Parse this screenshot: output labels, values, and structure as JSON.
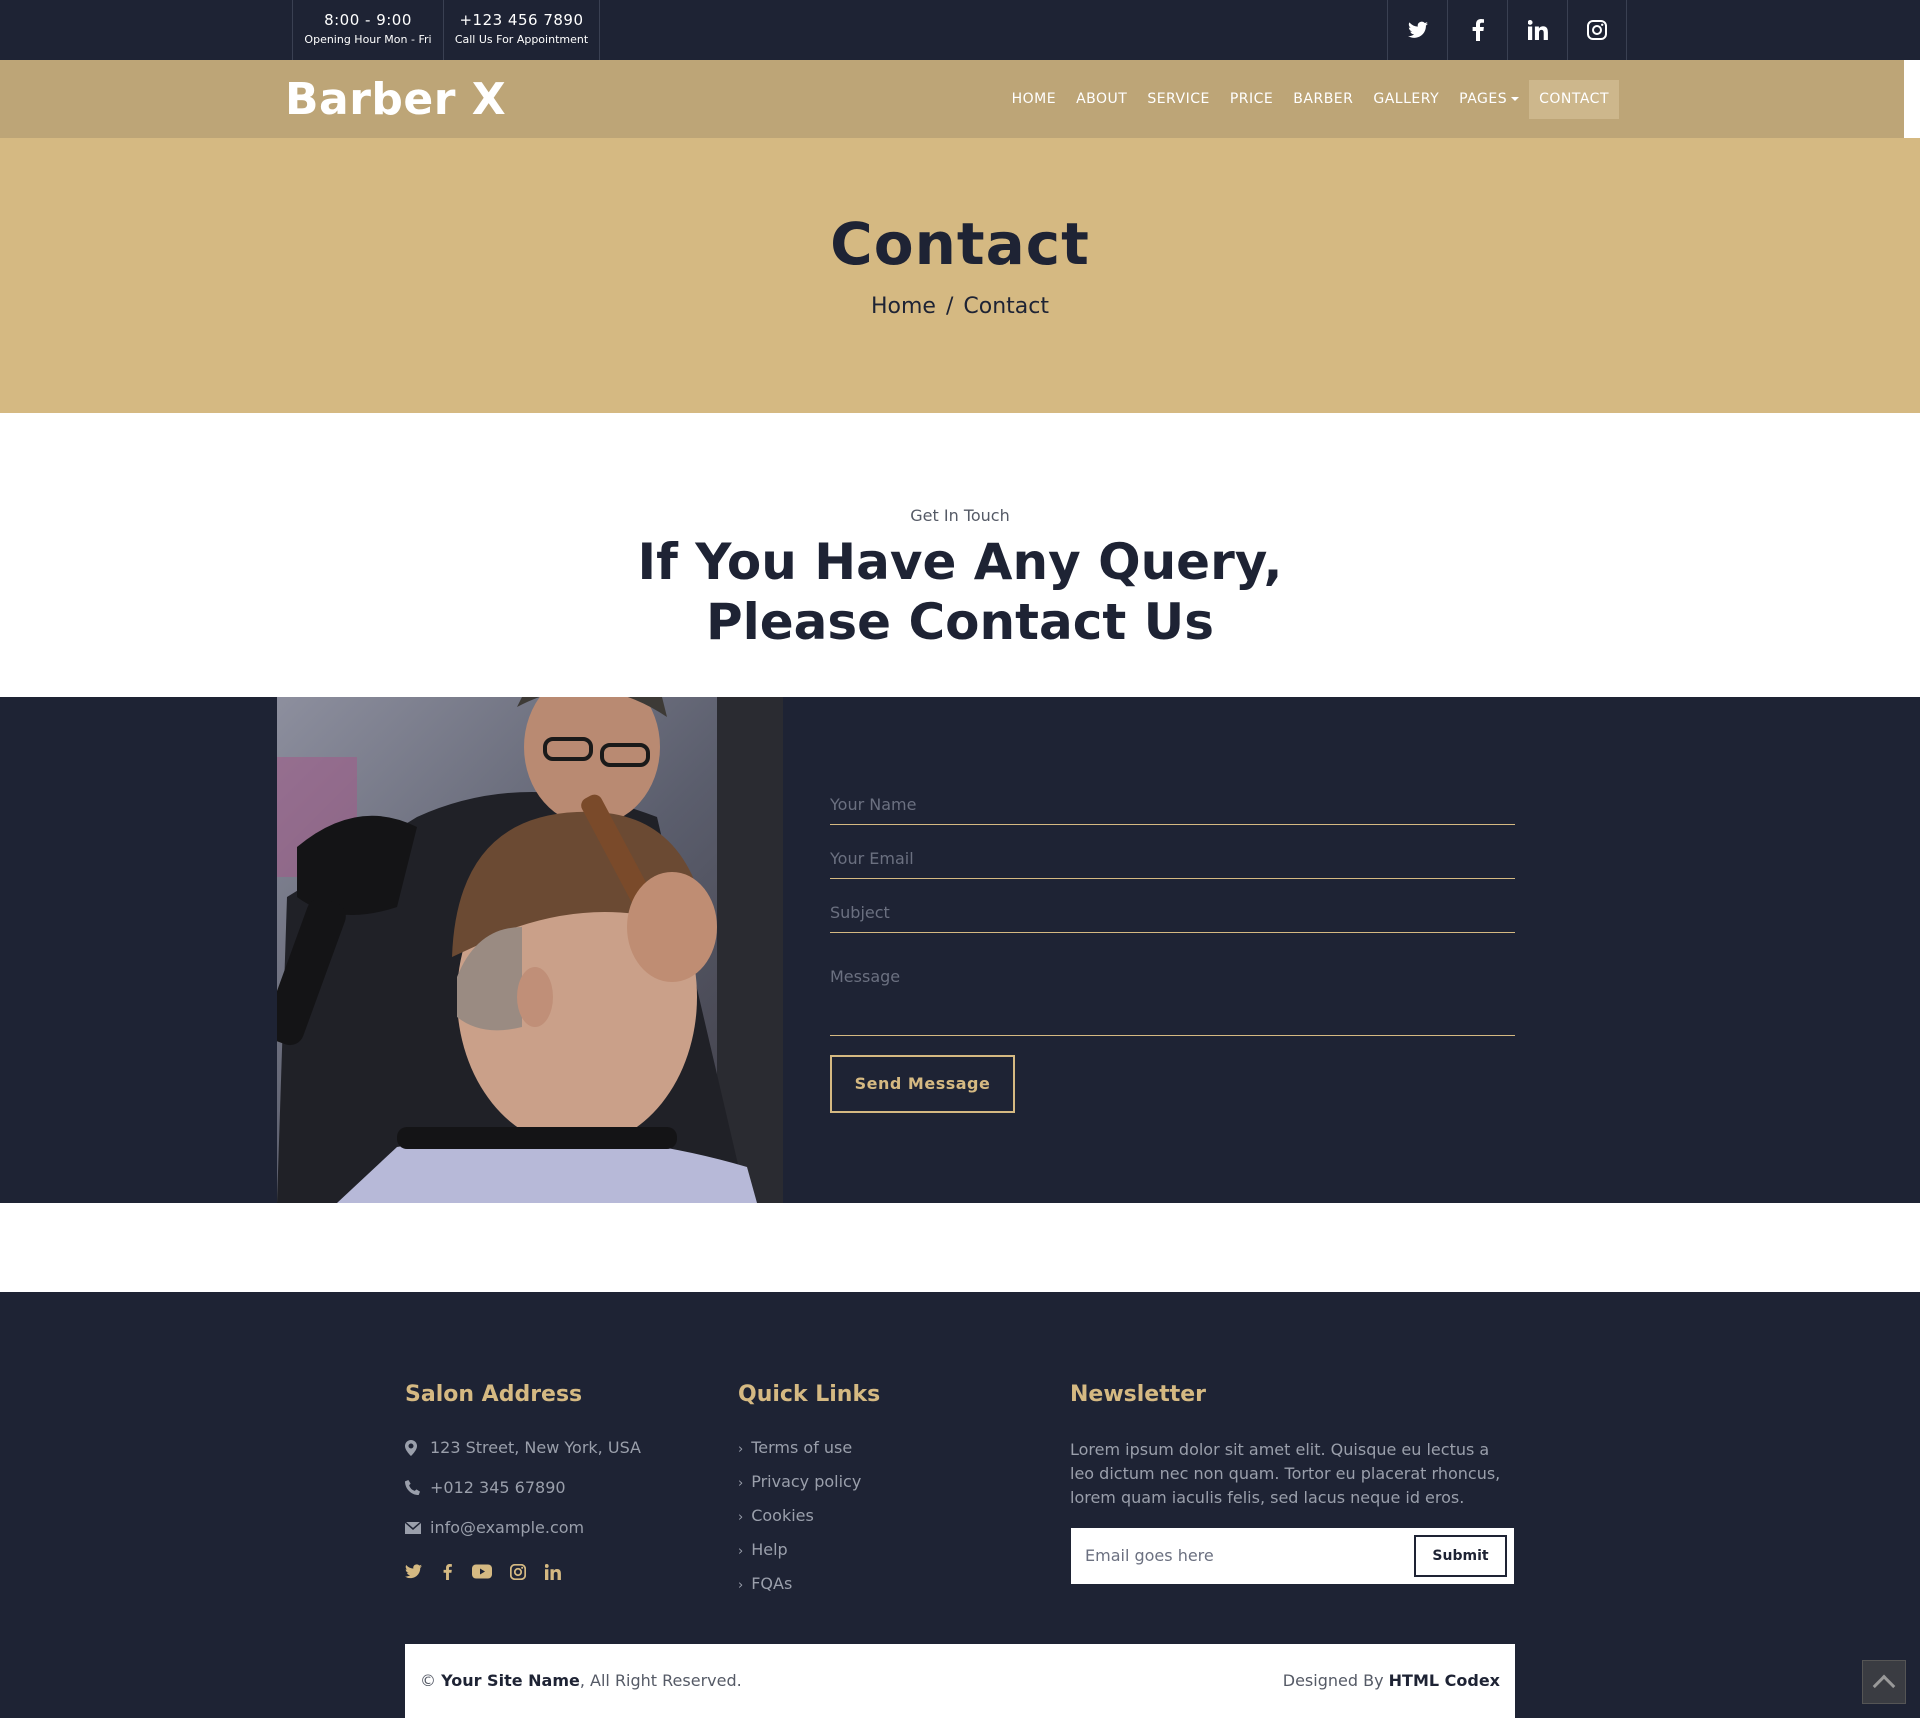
{
  "topbar": {
    "hours": {
      "time": "8:00 - 9:00",
      "label": "Opening Hour Mon - Fri"
    },
    "phone": {
      "number": "+123 456 7890",
      "label": "Call Us For Appointment"
    },
    "social_icons": [
      "twitter-icon",
      "facebook-icon",
      "linkedin-icon",
      "instagram-icon"
    ]
  },
  "navbar": {
    "logo": "Barber X",
    "items": [
      {
        "label": "HOME"
      },
      {
        "label": "ABOUT"
      },
      {
        "label": "SERVICE"
      },
      {
        "label": "PRICE"
      },
      {
        "label": "BARBER"
      },
      {
        "label": "GALLERY"
      },
      {
        "label": "PAGES"
      },
      {
        "label": "CONTACT"
      }
    ],
    "active": "CONTACT"
  },
  "page_header": {
    "title": "Contact",
    "breadcrumb": {
      "home": "Home",
      "separator": "/",
      "current": "Contact"
    }
  },
  "section": {
    "subtitle": "Get In Touch",
    "title_line1": "If You Have Any Query,",
    "title_line2": "Please Contact Us"
  },
  "form": {
    "name_placeholder": "Your Name",
    "email_placeholder": "Your Email",
    "subject_placeholder": "Subject",
    "message_placeholder": "Message",
    "send_label": "Send Message"
  },
  "footer": {
    "address": {
      "heading": "Salon Address",
      "street": "123 Street, New York, USA",
      "phone": "+012 345 67890",
      "email": "info@example.com",
      "social_icons": [
        "twitter-icon",
        "facebook-icon",
        "youtube-icon",
        "instagram-icon",
        "linkedin-icon"
      ]
    },
    "quick_links": {
      "heading": "Quick Links",
      "items": [
        "Terms of use",
        "Privacy policy",
        "Cookies",
        "Help",
        "FQAs"
      ]
    },
    "newsletter": {
      "heading": "Newsletter",
      "text": "Lorem ipsum dolor sit amet elit. Quisque eu lectus a leo dictum nec non quam. Tortor eu placerat rhoncus, lorem quam iaculis felis, sed lacus neque id eros.",
      "email_placeholder": "Email goes here",
      "submit_label": "Submit"
    },
    "copyright": {
      "prefix": "©",
      "site_name": "Your Site Name",
      "suffix": ", All Right Reserved.",
      "designed_by": "Designed By",
      "designer": "HTML Codex"
    }
  },
  "colors": {
    "dark": "#1e2334",
    "gold": "#d5b982",
    "nav_gold": "#bda577"
  }
}
